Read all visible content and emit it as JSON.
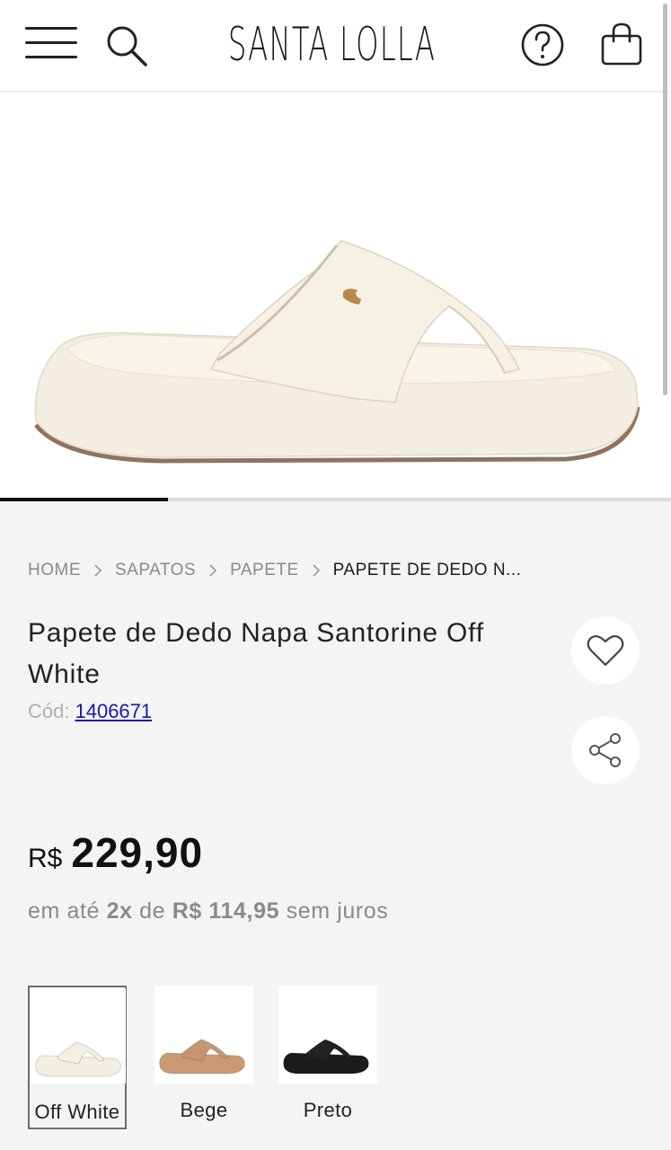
{
  "header": {
    "brand": "SANTA LOLLA",
    "icons": [
      "menu-icon",
      "search-icon",
      "help-icon",
      "bag-icon"
    ]
  },
  "gallery": {
    "current_slide": 1,
    "progress_fraction": 0.25
  },
  "breadcrumb": {
    "items": [
      "HOME",
      "SAPATOS",
      "PAPETE",
      "PAPETE DE DEDO N..."
    ]
  },
  "product": {
    "title": "Papete de Dedo Napa Santorine Off White",
    "code_label": "Cód:",
    "code_value": "1406671"
  },
  "price": {
    "currency": "R$",
    "value": "229,90",
    "installment_prefix": "em até",
    "installment_count": "2x",
    "installment_of": "de",
    "installment_value": "R$ 114,95",
    "installment_suffix": "sem juros"
  },
  "colors": {
    "selected": "Off White",
    "options": [
      {
        "label": "Off White",
        "sole_color": "#f3eee2",
        "strap_color": "#f4efe3"
      },
      {
        "label": "Bege",
        "sole_color": "#c99a72",
        "strap_color": "#c49570"
      },
      {
        "label": "Preto",
        "sole_color": "#1b1b1b",
        "strap_color": "#222222"
      }
    ]
  },
  "theme": {
    "background": "#f4f4f4",
    "text": "#222222",
    "link": "#1a1aa8"
  }
}
